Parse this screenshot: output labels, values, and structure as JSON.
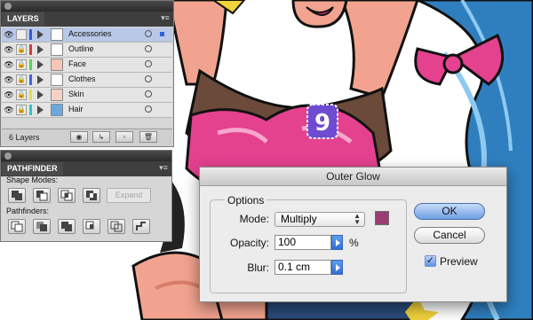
{
  "layers_panel": {
    "tab": "LAYERS",
    "rows": [
      {
        "name": "Accessories",
        "color": "#3b56d8",
        "selected": true
      },
      {
        "name": "Outline",
        "color": "#d33c3c",
        "selected": false
      },
      {
        "name": "Face",
        "color": "#4bd84b",
        "selected": false
      },
      {
        "name": "Clothes",
        "color": "#3f67d8",
        "selected": false
      },
      {
        "name": "Skin",
        "color": "#e0e040",
        "selected": false
      },
      {
        "name": "Hair",
        "color": "#2bc6c6",
        "selected": false
      }
    ],
    "count_label": "6 Layers"
  },
  "pathfinder_panel": {
    "tab": "PATHFINDER",
    "shape_modes_label": "Shape Modes:",
    "pathfinders_label": "Pathfinders:",
    "expand_label": "Expand"
  },
  "dialog": {
    "title": "Outer Glow",
    "options_label": "Options",
    "mode_label": "Mode:",
    "mode_value": "Multiply",
    "color_swatch": "#9a3d72",
    "opacity_label": "Opacity:",
    "opacity_value": "100",
    "opacity_unit": "%",
    "blur_label": "Blur:",
    "blur_value": "0.1 cm",
    "ok_label": "OK",
    "cancel_label": "Cancel",
    "preview_label": "Preview",
    "preview_checked": true
  },
  "illustration": {
    "badge_digit": "9"
  }
}
